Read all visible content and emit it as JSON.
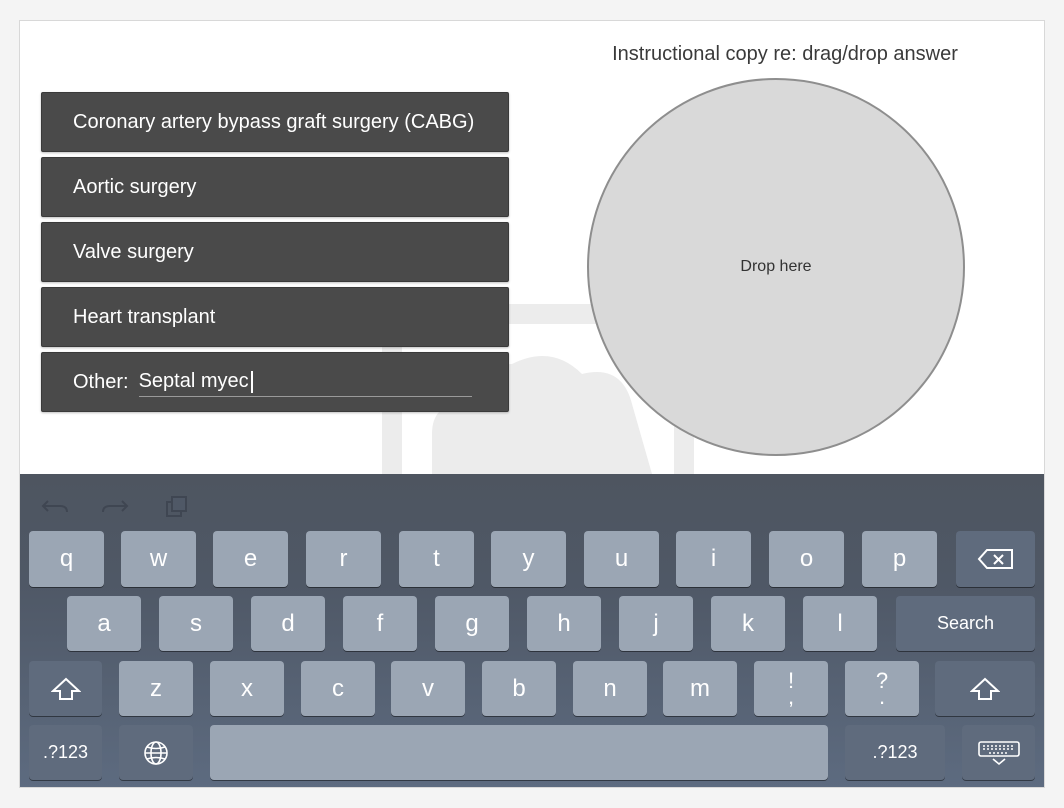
{
  "instruction": "Instructional copy re: drag/drop answer",
  "options": [
    "Coronary artery bypass graft surgery (CABG)",
    "Aortic surgery",
    "Valve surgery",
    "Heart transplant"
  ],
  "other": {
    "label": "Other:",
    "value": "Septal myec"
  },
  "drop_zone": {
    "label": "Drop here"
  },
  "keyboard": {
    "row1": [
      "q",
      "w",
      "e",
      "r",
      "t",
      "y",
      "u",
      "i",
      "o",
      "p"
    ],
    "row2": [
      "a",
      "s",
      "d",
      "f",
      "g",
      "h",
      "j",
      "k",
      "l"
    ],
    "row3": [
      "z",
      "x",
      "c",
      "v",
      "b",
      "n",
      "m"
    ],
    "punct1": [
      "!",
      ","
    ],
    "punct2": [
      "?",
      "."
    ],
    "search_label": "Search",
    "numbers_label": ".?123",
    "icons": [
      "undo-icon",
      "redo-icon",
      "paste-icon",
      "backspace-icon",
      "shift-icon",
      "globe-icon",
      "keyboard-dismiss-icon"
    ]
  }
}
